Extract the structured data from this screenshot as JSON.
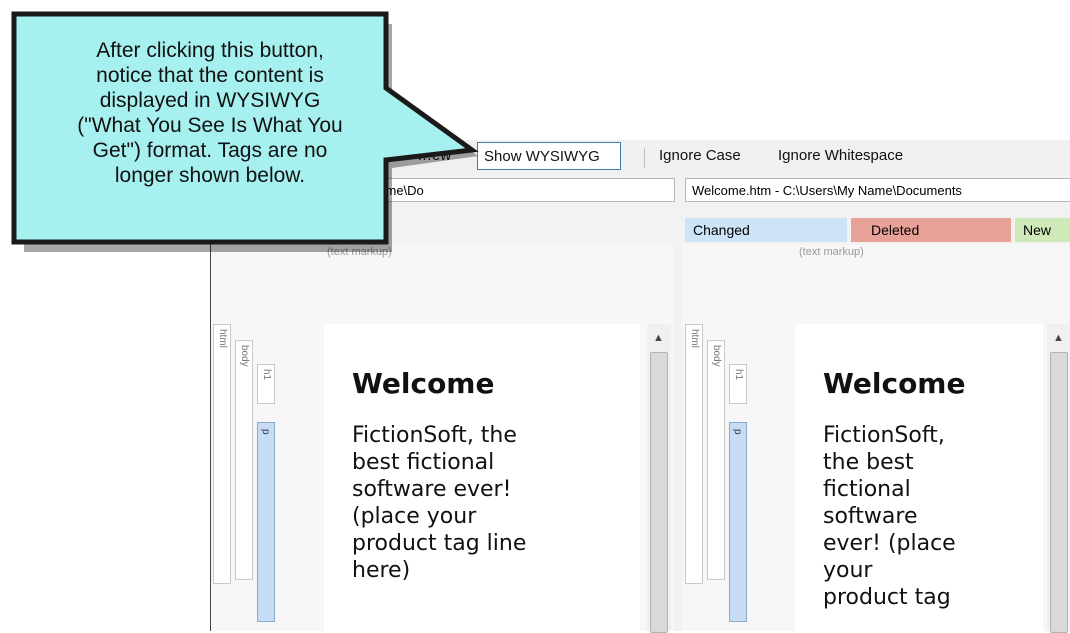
{
  "callout": {
    "lines": [
      "After clicking this button,",
      "notice that the content is",
      "displayed in WYSIWYG",
      "(\"What You See Is What You",
      "Get\") format. Tags are no",
      "longer shown below."
    ]
  },
  "toolbar": {
    "hidden_label": "…ew",
    "show_wysiwyg": "Show WYSIWYG",
    "ignore_case": "Ignore Case",
    "ignore_whitespace": "Ignore Whitespace"
  },
  "paths": {
    "left": "7554.htm - C:\\Users\\My Name\\Do",
    "right": "Welcome.htm - C:\\Users\\My Name\\Documents"
  },
  "legend": {
    "changed": "Changed",
    "deleted": "Deleted",
    "new": "New"
  },
  "markup_label": "(text markup)",
  "tags": {
    "html": "html",
    "body": "body",
    "h1": "h1",
    "p": "p"
  },
  "left_doc": {
    "heading": "Welcome",
    "lines": [
      "FictionSoft, the",
      "best fictional",
      "software ever!",
      "(place your",
      "product tag line",
      "here)"
    ]
  },
  "right_doc": {
    "heading": "Welcome",
    "lines": [
      "FictionSoft,",
      "the best",
      "fictional",
      "software",
      "ever! (place",
      "your",
      "product tag"
    ]
  },
  "colors": {
    "callout_fill": "#a6f0ef",
    "changed": "#cde3f8",
    "deleted": "#e8a196",
    "new": "#cfeab8",
    "button_border": "#3c7fb1"
  }
}
